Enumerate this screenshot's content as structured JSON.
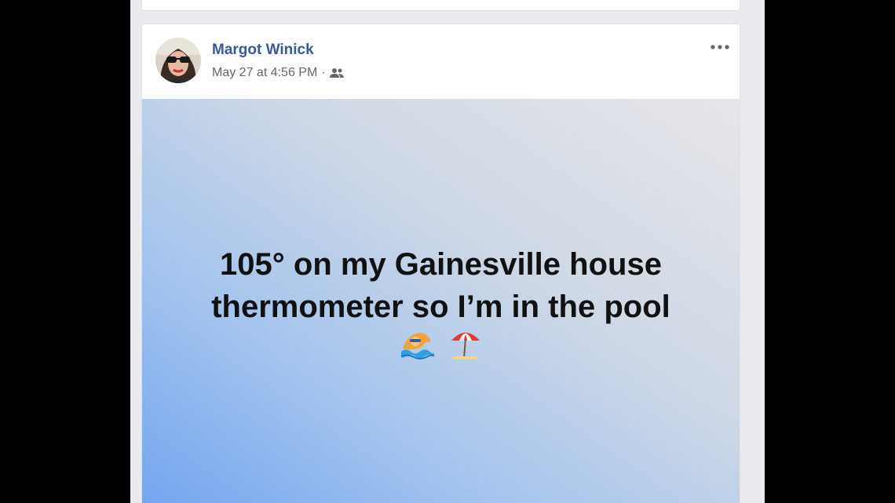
{
  "post": {
    "author": "Margot Winick",
    "timestamp": "May 27 at 4:56 PM",
    "separator": "·",
    "audience_icon": "friends-icon",
    "more_icon": "more-options-icon",
    "status_text_line1": "105° on my Gainesville house",
    "status_text_line2": "thermometer so I’m in the pool",
    "emojis": [
      "swimmer-emoji",
      "beach-umbrella-emoji"
    ],
    "colors": {
      "author_link": "#385898",
      "meta_text": "#606770",
      "feed_bg": "#e9ebee",
      "gradient_blue": "#6fa3ef",
      "gradient_gray": "#e6e6e8"
    }
  }
}
